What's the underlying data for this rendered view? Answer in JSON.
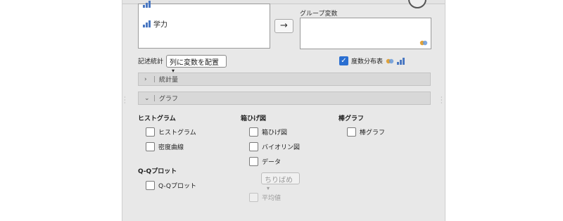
{
  "variables_box": {
    "items": [
      {
        "label": "学力"
      }
    ]
  },
  "transfer_button": {
    "label": "→"
  },
  "group_variable": {
    "label": "グループ変数"
  },
  "descriptives": {
    "label": "記述統計",
    "selected": "列に変数を配置"
  },
  "frequency_table": {
    "label": "度数分布表",
    "checked": true
  },
  "sections": {
    "statistics": "統計量",
    "graphs": "グラフ"
  },
  "histogram_group": {
    "heading": "ヒストグラム",
    "options": [
      {
        "label": "ヒストグラム"
      },
      {
        "label": "密度曲線"
      }
    ]
  },
  "qq_group": {
    "heading": "Q-Qプロット",
    "options": [
      {
        "label": "Q-Qプロット"
      }
    ]
  },
  "boxplot_group": {
    "heading": "箱ひげ図",
    "options": [
      {
        "label": "箱ひげ図"
      },
      {
        "label": "バイオリン図"
      },
      {
        "label": "データ"
      }
    ],
    "data_style": "ちりばめ",
    "mean_label": "平均値"
  },
  "bar_group": {
    "heading": "棒グラフ",
    "options": [
      {
        "label": "棒グラフ"
      }
    ]
  },
  "colors": {
    "accent": "#2b6fd1",
    "panel_bg": "#e8e8e8"
  }
}
